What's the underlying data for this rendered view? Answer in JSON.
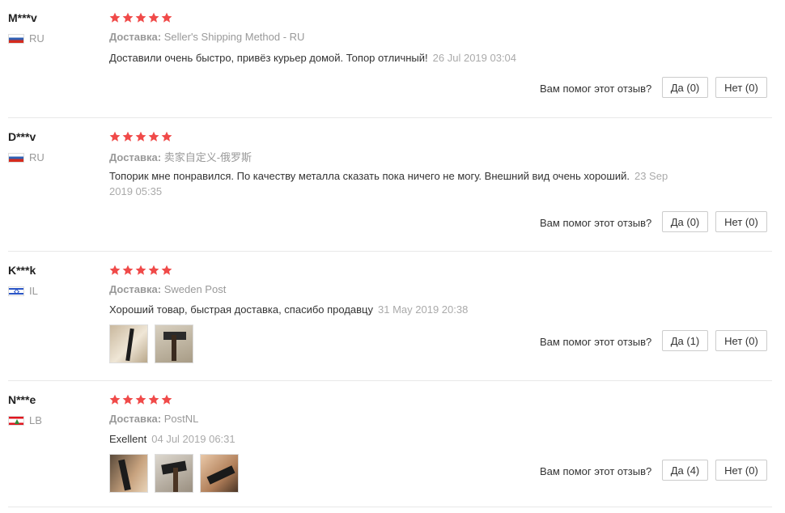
{
  "colors": {
    "star": "#f04a49",
    "muted": "#999999",
    "border": "#cccccc"
  },
  "rating_icon": "star-icon",
  "helpful_label": "Вам помог этот отзыв?",
  "shipping_label": "Доставка:",
  "reviews": [
    {
      "user": "M***v",
      "country": "RU",
      "flag_icon": "russia-flag-icon",
      "rating": 5,
      "shipping": "Seller's Shipping Method - RU",
      "text": "Доставили очень быстро, привёз курьер домой. Топор отличный!",
      "date": "26 Jul 2019 03:04",
      "yes_label": "Да (0)",
      "no_label": "Нет (0)",
      "photos": []
    },
    {
      "user": "D***v",
      "country": "RU",
      "flag_icon": "russia-flag-icon",
      "rating": 5,
      "shipping": "卖家自定义-俄罗斯",
      "text": "Топорик мне понравился. По качеству металла сказать пока ничего не могу. Внешний вид очень хороший.",
      "date": "23 Sep 2019 05:35",
      "yes_label": "Да (0)",
      "no_label": "Нет (0)",
      "photos": []
    },
    {
      "user": "K***k",
      "country": "IL",
      "flag_icon": "israel-flag-icon",
      "rating": 5,
      "shipping": "Sweden Post",
      "text": "Хороший товар, быстрая доставка, спасибо продавцу",
      "date": "31 May 2019 20:38",
      "yes_label": "Да (1)",
      "no_label": "Нет (0)",
      "photos": [
        "review-photo-axe",
        "review-photo-axe"
      ]
    },
    {
      "user": "N***e",
      "country": "LB",
      "flag_icon": "lebanon-flag-icon",
      "rating": 5,
      "shipping": "PostNL",
      "text": "Exellent",
      "date": "04 Jul 2019 06:31",
      "yes_label": "Да (4)",
      "no_label": "Нет (0)",
      "photos": [
        "review-photo-axe",
        "review-photo-axe",
        "review-photo-axe"
      ]
    }
  ]
}
